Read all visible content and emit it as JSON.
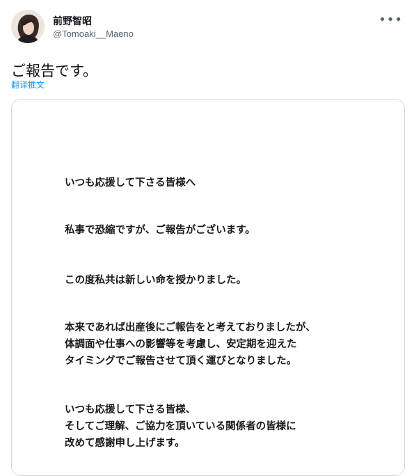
{
  "tweet": {
    "author_name": "前野智昭",
    "author_handle": "@Tomoaki__Maeno",
    "more_icon": "more-horizontal-icon",
    "text": "ご報告です。",
    "translate_label": "翻译推文"
  },
  "notice": {
    "line1": "いつも応援して下さる皆様へ",
    "line2": "私事で恐縮ですが、ご報告がございます。",
    "line3": "この度私共は新しい命を授かりました。",
    "line4": "本来であれば出産後にご報告をと考えておりましたが、",
    "line5": "体調面や仕事への影響等を考慮し、安定期を迎えた",
    "line6": "タイミングでご報告させて頂く運びとなりました。",
    "line7": "いつも応援して下さる皆様、",
    "line8": "そしてご理解、ご協力を頂いている関係者の皆様に",
    "line9": "改めて感謝申し上げます。"
  },
  "colors": {
    "link": "#1d9bf0",
    "secondary_text": "#536471",
    "border": "#cfd9de"
  }
}
